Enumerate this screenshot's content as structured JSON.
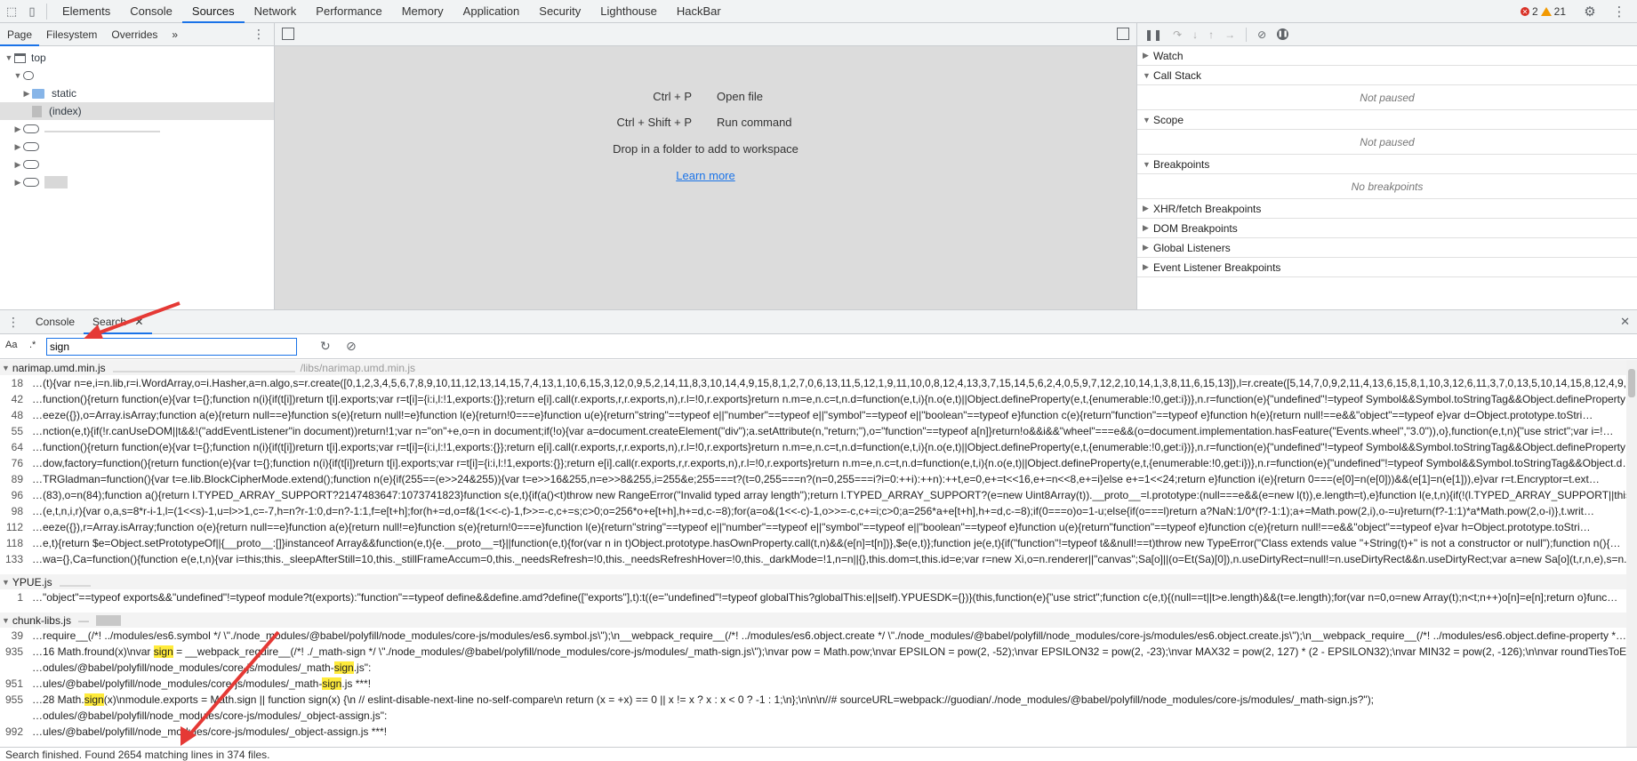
{
  "topbar": {
    "tabs": [
      "Elements",
      "Console",
      "Sources",
      "Network",
      "Performance",
      "Memory",
      "Application",
      "Security",
      "Lighthouse",
      "HackBar"
    ],
    "active_tab": "Sources",
    "error_count": "2",
    "warning_count": "21"
  },
  "navigator": {
    "tabs": [
      "Page",
      "Filesystem",
      "Overrides"
    ],
    "more": "»",
    "tree": {
      "top": "top",
      "static": "static",
      "index": "(index)"
    }
  },
  "editor": {
    "shortcuts": [
      {
        "keys": "Ctrl + P",
        "label": "Open file"
      },
      {
        "keys": "Ctrl + Shift + P",
        "label": "Run command"
      }
    ],
    "drop_text": "Drop in a folder to add to workspace",
    "learn_more": "Learn more"
  },
  "debugger": {
    "sections": {
      "watch": "Watch",
      "call_stack": "Call Stack",
      "call_stack_empty": "Not paused",
      "scope": "Scope",
      "scope_empty": "Not paused",
      "breakpoints": "Breakpoints",
      "breakpoints_empty": "No breakpoints",
      "xhr": "XHR/fetch Breakpoints",
      "dom": "DOM Breakpoints",
      "global": "Global Listeners",
      "event": "Event Listener Breakpoints"
    }
  },
  "drawer": {
    "tabs": [
      "Console",
      "Search"
    ],
    "active_tab": "Search",
    "match_case": "Aa",
    "regex": ".*",
    "query": "sign",
    "status": "Search finished.  Found 2654 matching lines in 374 files."
  },
  "results": [
    {
      "file": "narimap.umd.min.js",
      "path": "/libs/narimap.umd.min.js",
      "lines": [
        {
          "n": "18",
          "pre": "…(t){var n=e,i=n.lib,r=i.WordArray,o=i.Hasher,a=n.algo,s=r.create([0,1,2,3,4,5,6,7,8,9,10,11,12,13,14,15,7,4,13,1,10,6,15,3,12,0,9,5,2,14,11,8,3,10,14,4,9,15,8,1,2,7,0,6,13,11,5,12,1,9,11,10,0,8,12,4,13,3,7,15,14,5,6,2,4,0,5,9,7,12,2,10,14,1,3,8,11,6,15,13]),l=r.create([5,14,7,0,9,2,11,4,13,6,15,8,1,10,3,12,6,11,3,7,0,13,5,10,14,15,8,12,4,9,1,2,15,5,1,3,7,14,6,9…",
          "m": "",
          "post": ""
        },
        {
          "n": "42",
          "pre": "…function(){return function(e){var t={};function n(i){if(t[i])return t[i].exports;var r=t[i]={i:i,l:!1,exports:{}};return e[i].call(r.exports,r,r.exports,n),r.l=!0,r.exports}return n.m=e,n.c=t,n.d=function(e,t,i){n.o(e,t)||Object.defineProperty(e,t,{enumerable:!0,get:i})},n.r=function(e){\"undefined\"!=typeof Symbol&&Symbol.toStringTag&&Object.defineProperty…",
          "m": "",
          "post": ""
        },
        {
          "n": "48",
          "pre": "…eeze({}),o=Array.isArray;function a(e){return null==e}function s(e){return null!=e}function l(e){return!0===e}function u(e){return\"string\"==typeof e||\"number\"==typeof e||\"symbol\"==typeof e||\"boolean\"==typeof e}function c(e){return\"function\"==typeof e}function h(e){return null!==e&&\"object\"==typeof e}var d=Object.prototype.toStri…",
          "m": "",
          "post": ""
        },
        {
          "n": "55",
          "pre": "…nction(e,t){if(!r.canUseDOM||t&&!(\"addEventListener\"in document))return!1;var n=\"on\"+e,o=n in document;if(!o){var a=document.createElement(\"div\");a.setAttribute(n,\"return;\"),o=\"function\"==typeof a[n]}return!o&&i&&\"wheel\"===e&&(o=document.implementation.hasFeature(\"Events.wheel\",\"3.0\")),o},function(e,t,n){\"use strict\";var i=!…",
          "m": "",
          "post": ""
        },
        {
          "n": "64",
          "pre": "…function(){return function(e){var t={};function n(i){if(t[i])return t[i].exports;var r=t[i]={i:i,l:!1,exports:{}};return e[i].call(r.exports,r,r.exports,n),r.l=!0,r.exports}return n.m=e,n.c=t,n.d=function(e,t,i){n.o(e,t)||Object.defineProperty(e,t,{enumerable:!0,get:i})},n.r=function(e){\"undefined\"!=typeof Symbol&&Symbol.toStringTag&&Object.defineProperty…",
          "m": "",
          "post": ""
        },
        {
          "n": "76",
          "pre": "…dow,factory=function(){return function(e){var t={};function n(i){if(t[i])return t[i].exports;var r=t[i]={i:i,l:!1,exports:{}};return e[i].call(r.exports,r,r.exports,n),r.l=!0,r.exports}return n.m=e,n.c=t,n.d=function(e,t,i){n.o(e,t)||Object.defineProperty(e,t,{enumerable:!0,get:i})},n.r=function(e){\"undefined\"!=typeof Symbol&&Symbol.toStringTag&&Object.d…",
          "m": "",
          "post": ""
        },
        {
          "n": "89",
          "pre": "…TRGladman=function(){var t=e.lib.BlockCipherMode.extend();function n(e){if(255==(e>>24&255)){var t=e>>16&255,n=e>>8&255,i=255&e;255===t?(t=0,255===n?(n=0,255===i?i=0:++i):++n):++t,e=0,e+=t<<16,e+=n<<8,e+=i}else e+=1<<24;return e}function i(e){return 0===(e[0]=n(e[0]))&&(e[1]=n(e[1])),e}var r=t.Encryptor=t.ext…",
          "m": "",
          "post": ""
        },
        {
          "n": "96",
          "pre": "…(83),o=n(84);function a(){return l.TYPED_ARRAY_SUPPORT?2147483647:1073741823}function s(e,t){if(a()<t)throw new RangeError(\"Invalid typed array length\");return l.TYPED_ARRAY_SUPPORT?(e=new Uint8Array(t)).__proto__=l.prototype:(null===e&&(e=new l(t)),e.length=t),e}function l(e,t,n){if(!(l.TYPED_ARRAY_SUPPORT||this instanceof l…",
          "m": "",
          "post": ""
        },
        {
          "n": "98",
          "pre": "…(e,t,n,i,r){var o,a,s=8*r-i-1,l=(1<<s)-1,u=l>>1,c=-7,h=n?r-1:0,d=n?-1:1,f=e[t+h];for(h+=d,o=f&(1<<-c)-1,f>>=-c,c+=s;c>0;o=256*o+e[t+h],h+=d,c-=8);for(a=o&(1<<-c)-1,o>>=-c,c+=i;c>0;a=256*a+e[t+h],h+=d,c-=8);if(0===o)o=1-u;else{if(o===l)return a?NaN:1/0*(f?-1:1);a+=Math.pow(2,i),o-=u}return(f?-1:1)*a*Math.pow(2,o-i)},t.writ…",
          "m": "",
          "post": ""
        },
        {
          "n": "112",
          "pre": "…eeze({}),r=Array.isArray;function o(e){return null==e}function a(e){return null!=e}function s(e){return!0===e}function l(e){return\"string\"==typeof e||\"number\"==typeof e||\"symbol\"==typeof e||\"boolean\"==typeof e}function u(e){return\"function\"==typeof e}function c(e){return null!==e&&\"object\"==typeof e}var h=Object.prototype.toStri…",
          "m": "",
          "post": ""
        },
        {
          "n": "118",
          "pre": "…e,t){return $e=Object.setPrototypeOf||{__proto__:[]}instanceof Array&&function(e,t){e.__proto__=t}||function(e,t){for(var n in t)Object.prototype.hasOwnProperty.call(t,n)&&(e[n]=t[n])},$e(e,t)};function je(e,t){if(\"function\"!=typeof t&&null!==t)throw new TypeError(\"Class extends value \"+String(t)+\" is not a constructor or null\");function n(){…",
          "m": "",
          "post": ""
        },
        {
          "n": "133",
          "pre": "…wa={},Ca=function(){function e(e,t,n){var i=this;this._sleepAfterStill=10,this._stillFrameAccum=0,this._needsRefresh=!0,this._needsRefreshHover=!0,this._darkMode=!1,n=n||{},this.dom=t,this.id=e;var r=new Xi,o=n.renderer||\"canvas\";Sa[o]||(o=Et(Sa)[0]),n.useDirtyRect=null!=n.useDirtyRect&&n.useDirtyRect;var a=new Sa[o](t,r,n,e),s=n.ssr||a…",
          "m": "",
          "post": ""
        }
      ]
    },
    {
      "file": "YPUE.js",
      "path": "",
      "lines": [
        {
          "n": "1",
          "pre": "…\"object\"==typeof exports&&\"undefined\"!=typeof module?t(exports):\"function\"==typeof define&&define.amd?define([\"exports\"],t):t((e=\"undefined\"!=typeof globalThis?globalThis:e||self).YPUESDK={})}(this,function(e){\"use strict\";function c(e,t){(null==t||t>e.length)&&(t=e.length);for(var n=0,o=new Array(t);n<t;n++)o[n]=e[n];return o}func…",
          "m": "",
          "post": ""
        }
      ]
    },
    {
      "file": "chunk-libs.js",
      "path": "",
      "lines": [
        {
          "n": "39",
          "pre": "…require__(/*! ../modules/es6.symbol */ \\\"./node_modules/@babel/polyfill/node_modules/core-js/modules/es6.symbol.js\\\");\\n__webpack_require__(/*! ../modules/es6.object.create */ \\\"./node_modules/@babel/polyfill/node_modules/core-js/modules/es6.object.create.js\\\");\\n__webpack_require__(/*! ../modules/es6.object.define-property *…",
          "m": "",
          "post": ""
        },
        {
          "n": "935",
          "pre": "…16 Math.fround(x)\\nvar ",
          "m": "sign",
          "post": " = __webpack_require__(/*! ./_math-sign */ \\\"./node_modules/@babel/polyfill/node_modules/core-js/modules/_math-sign.js\\\");\\nvar pow = Math.pow;\\nvar EPSILON = pow(2, -52);\\nvar EPSILON32 = pow(2, -23);\\nvar MAX32 = pow(2, 127) * (2 - EPSILON32);\\nvar MIN32 = pow(2, -126);\\n\\nvar roundTiesToE…"
        },
        {
          "n": "",
          "pre": "…odules/@babel/polyfill/node_modules/core-js/modules/_math-",
          "m": "sign",
          "post": ".js\":"
        },
        {
          "n": "951",
          "pre": "…ules/@babel/polyfill/node_modules/core-js/modules/_math-",
          "m": "sign",
          "post": ".js ***!"
        },
        {
          "n": "955",
          "pre": "…28 Math.",
          "m": "sign",
          "post": "(x)\\nmodule.exports = Math.sign || function sign(x) {\\n  // eslint-disable-next-line no-self-compare\\n  return (x = +x) == 0 || x != x ? x : x < 0 ? -1 : 1;\\n};\\n\\n\\n//# sourceURL=webpack://guodian/./node_modules/@babel/polyfill/node_modules/core-js/modules/_math-sign.js?\");"
        },
        {
          "n": "",
          "pre": "…odules/@babel/polyfill/node_modules/core-js/modules/_object-assign.js\":",
          "m": "",
          "post": ""
        },
        {
          "n": "992",
          "pre": "…ules/@babel/polyfill/node_modules/core-js/modules/_object-assign.js ***!",
          "m": "",
          "post": ""
        }
      ]
    }
  ]
}
